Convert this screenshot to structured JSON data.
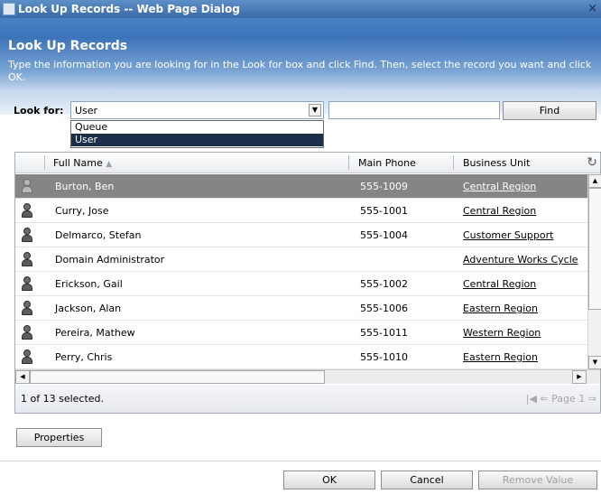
{
  "window": {
    "title": "Look Up Records -- Web Page Dialog",
    "close_glyph": "×"
  },
  "header": {
    "title": "Look Up Records",
    "description": "Type the information you are looking for in the Look for box and click Find. Then, select the record you want and click OK."
  },
  "search": {
    "look_for_label": "Look for:",
    "selected_entity": "User",
    "options": [
      "Queue",
      "User"
    ],
    "query": "",
    "find_label": "Find"
  },
  "grid": {
    "columns": [
      "Full Name",
      "Main Phone",
      "Business Unit"
    ],
    "sort_column": "Full Name",
    "sort_indicator": "▲",
    "rows": [
      {
        "name": "Burton, Ben",
        "phone": "555-1009",
        "unit": "Central Region",
        "selected": true
      },
      {
        "name": "Curry, Jose",
        "phone": "555-1001",
        "unit": "Central Region"
      },
      {
        "name": "Delmarco, Stefan",
        "phone": "555-1004",
        "unit": "Customer Support"
      },
      {
        "name": "Domain Administrator",
        "phone": "",
        "unit": "Adventure Works Cycle"
      },
      {
        "name": "Erickson, Gail",
        "phone": "555-1002",
        "unit": "Central Region"
      },
      {
        "name": "Jackson, Alan",
        "phone": "555-1006",
        "unit": "Eastern Region"
      },
      {
        "name": "Pereira, Mathew",
        "phone": "555-1011",
        "unit": "Western Region"
      },
      {
        "name": "Perry, Chris",
        "phone": "555-1010",
        "unit": "Eastern Region"
      }
    ],
    "selection_status": "1 of 13 selected.",
    "page_label": "Page 1"
  },
  "buttons": {
    "properties": "Properties",
    "ok": "OK",
    "cancel": "Cancel",
    "remove_value": "Remove Value"
  },
  "colors": {
    "header_blue": "#3d74b9",
    "selected_row": "#858585",
    "dropdown_highlight": "#1b2f4a"
  }
}
